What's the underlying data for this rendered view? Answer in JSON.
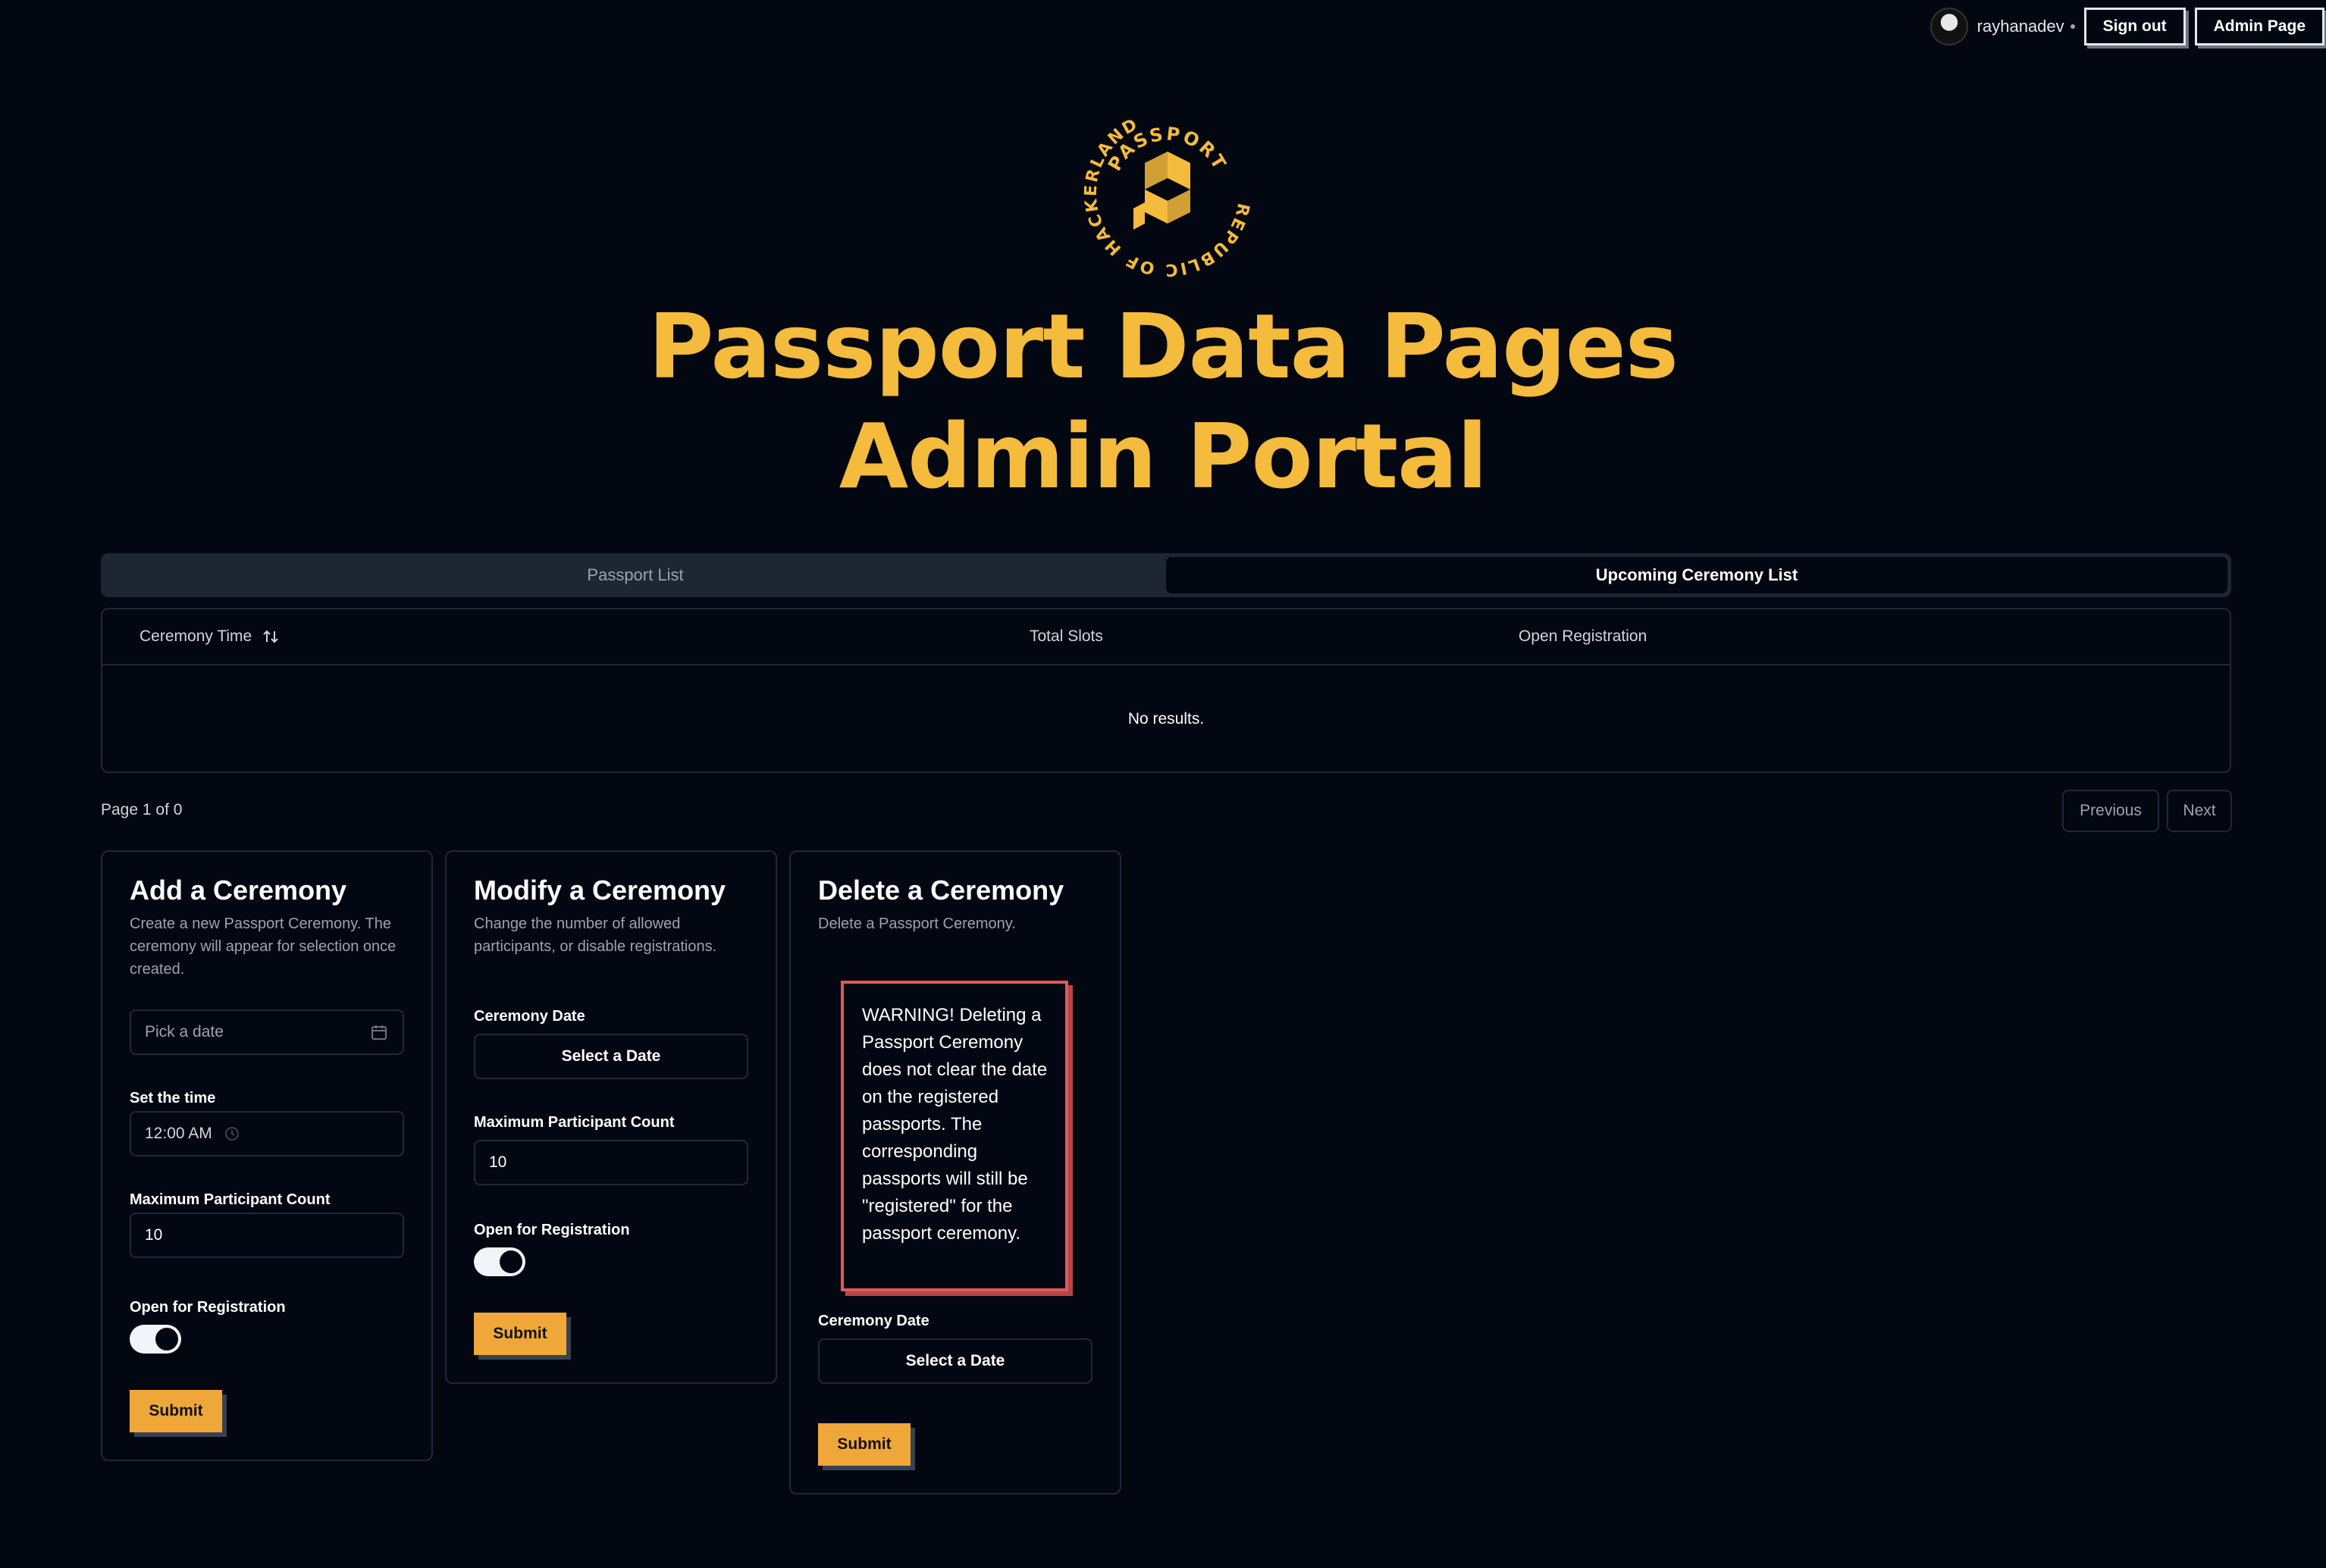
{
  "header": {
    "username": "rayhanadev",
    "sign_out_label": "Sign out",
    "admin_page_label": "Admin Page"
  },
  "logo": {
    "top_text": "PASSPORT",
    "ring_text": "REPUBLIC OF HACKERLAND",
    "color": "#f4bb3c"
  },
  "title": {
    "line1": "Passport Data Pages",
    "line2": "Admin Portal"
  },
  "tabs": [
    {
      "label": "Passport List",
      "active": false
    },
    {
      "label": "Upcoming Ceremony List",
      "active": true
    }
  ],
  "table": {
    "columns": [
      "Ceremony Time",
      "Total Slots",
      "Open Registration"
    ],
    "sort_icon": "arrow-up-down-icon",
    "empty_text": "No results."
  },
  "pagination": {
    "info": "Page 1 of 0",
    "previous_label": "Previous",
    "next_label": "Next"
  },
  "add_card": {
    "title": "Add a Ceremony",
    "description": "Create a new Passport Ceremony. The ceremony will appear for selection once created.",
    "date_placeholder": "Pick a date",
    "time_label": "Set the time",
    "time_value": "12:00 AM",
    "max_label": "Maximum Participant Count",
    "max_value": "10",
    "open_label": "Open for Registration",
    "open_value": true,
    "submit_label": "Submit"
  },
  "modify_card": {
    "title": "Modify a Ceremony",
    "description": "Change the number of allowed participants, or disable registrations.",
    "date_label": "Ceremony Date",
    "date_button": "Select a Date",
    "max_label": "Maximum Participant Count",
    "max_value": "10",
    "open_label": "Open for Registration",
    "open_value": true,
    "submit_label": "Submit"
  },
  "delete_card": {
    "title": "Delete a Ceremony",
    "description": "Delete a Passport Ceremony.",
    "warning": "WARNING! Deleting a Passport Ceremony does not clear the date on the registered passports. The corresponding passports will still be \"registered\" for the passport ceremony.",
    "date_label": "Ceremony Date",
    "date_button": "Select a Date",
    "submit_label": "Submit"
  },
  "colors": {
    "background": "#030712",
    "accent": "#f4bb3c",
    "button": "#f0a73a",
    "warning": "#e05959"
  }
}
